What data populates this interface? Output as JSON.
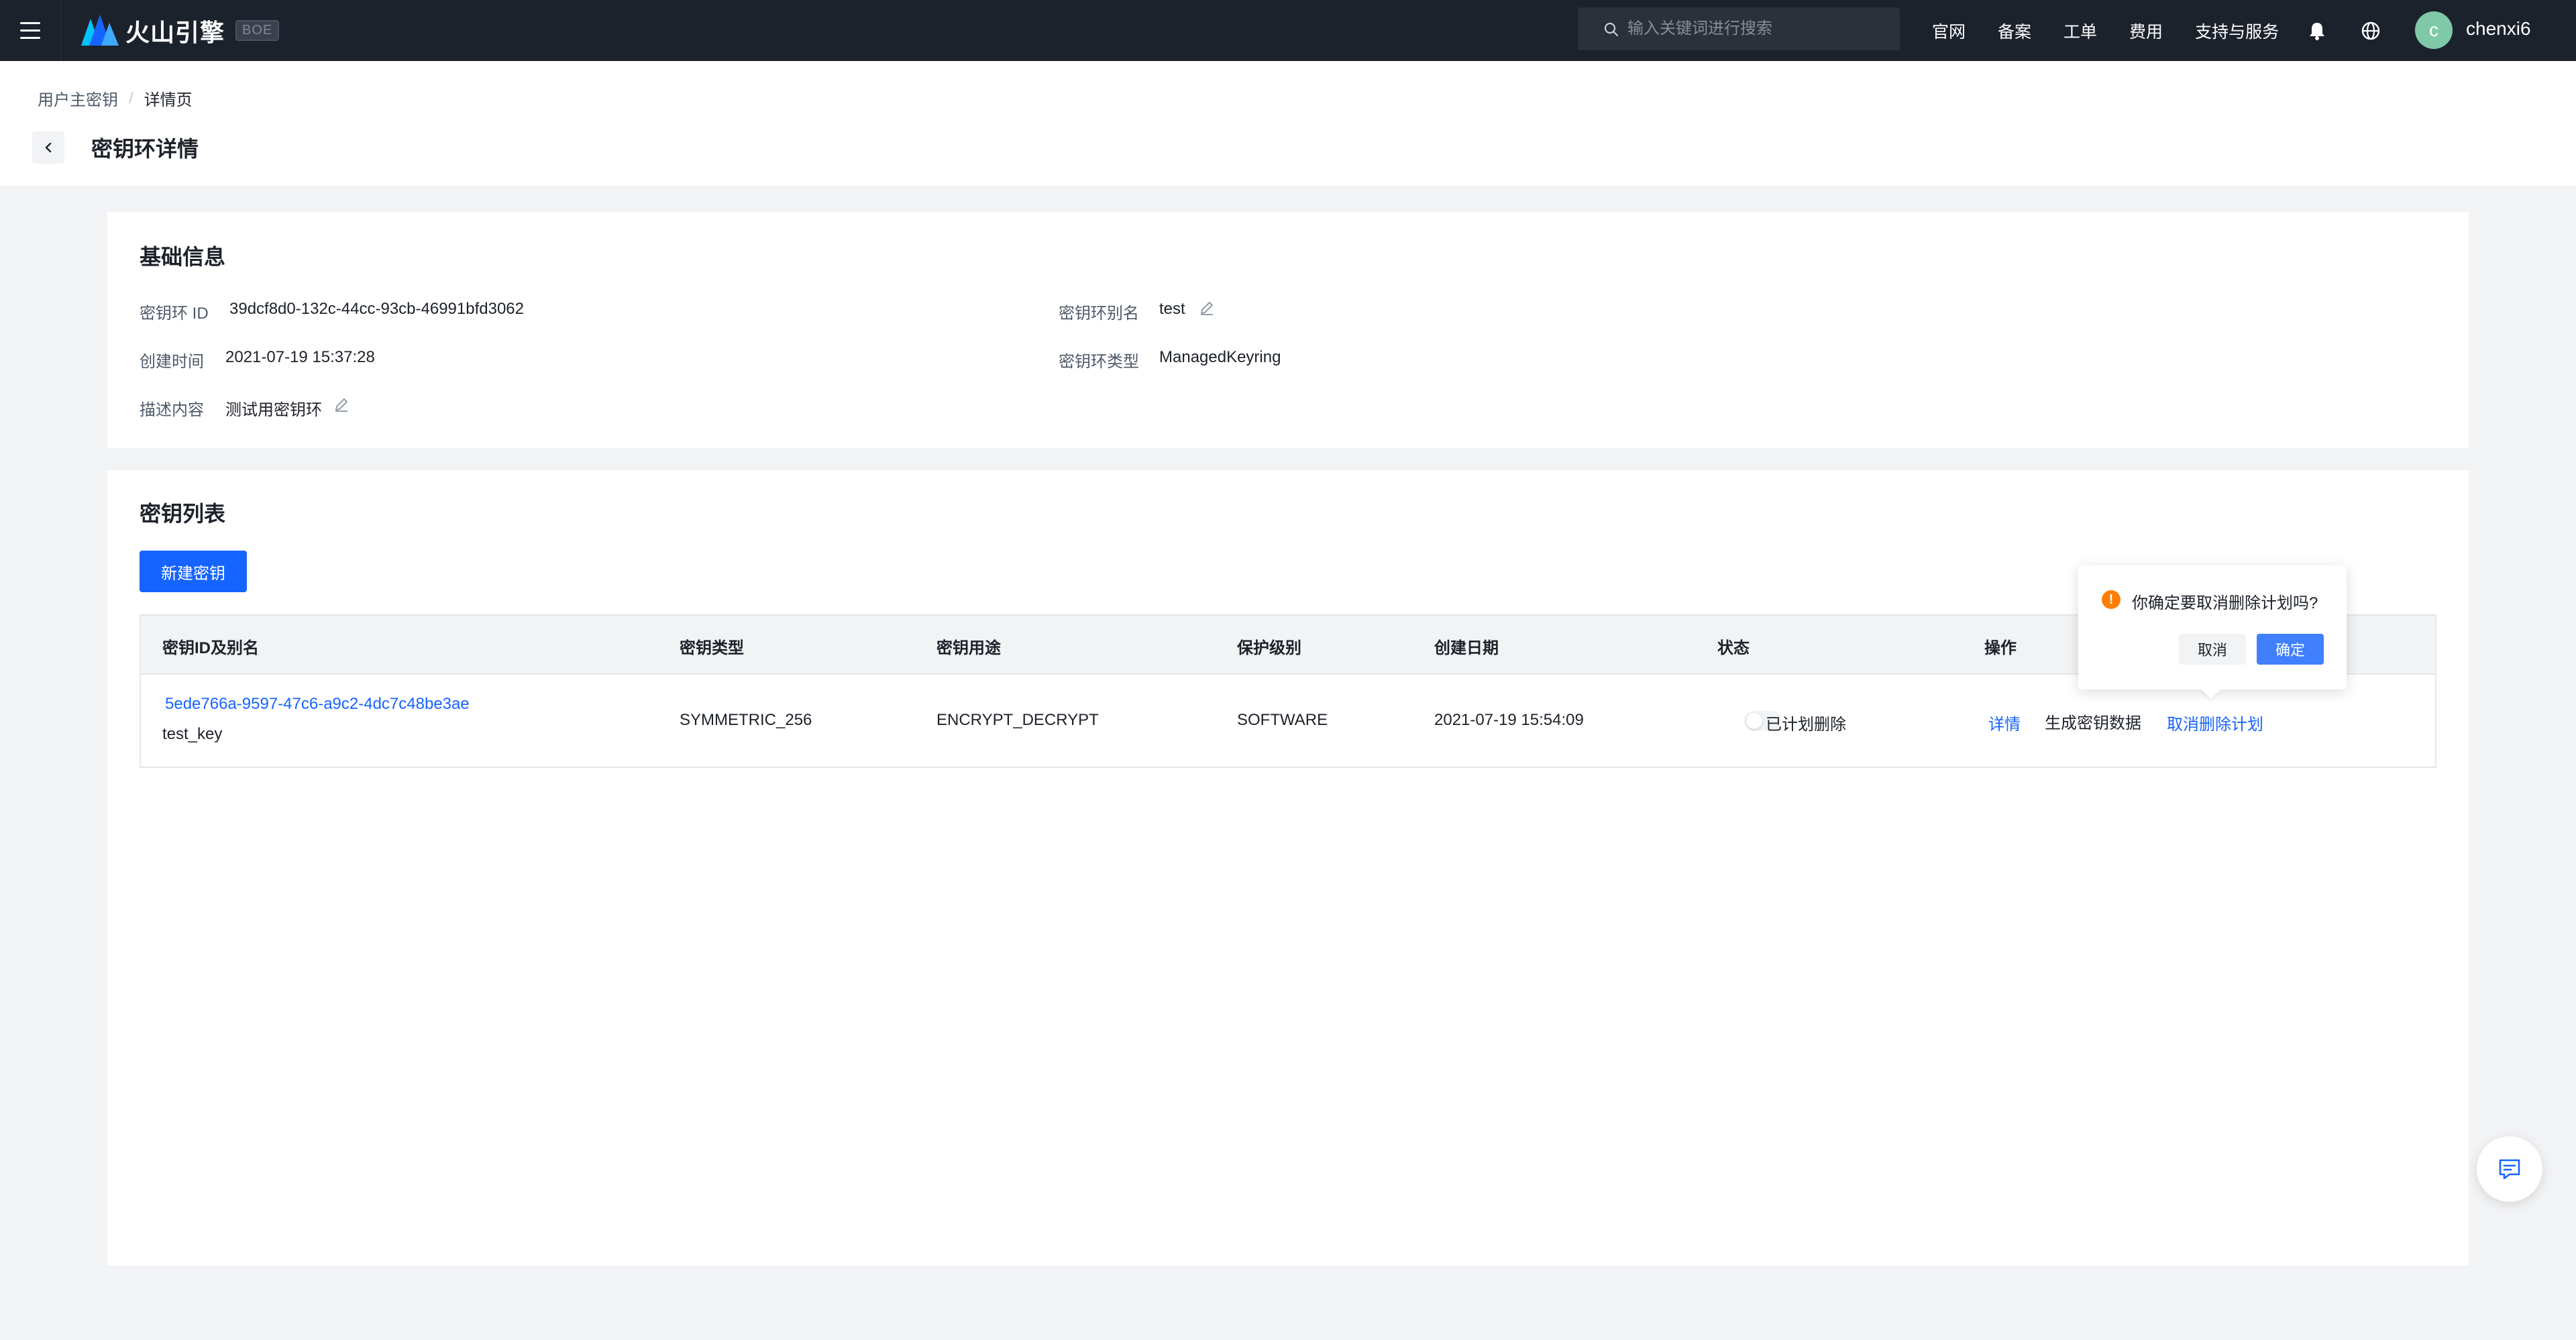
{
  "topbar": {
    "brand_name": "火山引擎",
    "env_badge": "BOE",
    "search_placeholder": "输入关键词进行搜索",
    "nav": [
      "官网",
      "备案",
      "工单",
      "费用",
      "支持与服务"
    ],
    "avatar_letter": "c",
    "username": "chenxi6"
  },
  "breadcrumb": {
    "parent": "用户主密钥",
    "separator": "/",
    "current": "详情页"
  },
  "page_title": "密钥环详情",
  "basic_info": {
    "title": "基础信息",
    "keyring_id_label": "密钥环 ID",
    "keyring_id": "39dcf8d0-132c-44cc-93cb-46991bfd3062",
    "alias_label": "密钥环别名",
    "alias": "test",
    "created_label": "创建时间",
    "created": "2021-07-19 15:37:28",
    "type_label": "密钥环类型",
    "type": "ManagedKeyring",
    "desc_label": "描述内容",
    "desc": "测试用密钥环"
  },
  "key_list": {
    "title": "密钥列表",
    "new_button": "新建密钥",
    "columns": [
      "密钥ID及别名",
      "密钥类型",
      "密钥用途",
      "保护级别",
      "创建日期",
      "状态",
      "操作"
    ],
    "rows": [
      {
        "key_id": "5ede766a-9597-47c6-a9c2-4dc7c48be3ae",
        "alias": "test_key",
        "key_type": "SYMMETRIC_256",
        "usage": "ENCRYPT_DECRYPT",
        "protection": "SOFTWARE",
        "created": "2021-07-19 15:54:09",
        "status": "已计划删除",
        "actions": {
          "detail": "详情",
          "generate": "生成密钥数据",
          "cancel_delete": "取消删除计划"
        }
      }
    ]
  },
  "popconfirm": {
    "message": "你确定要取消删除计划吗?",
    "cancel": "取消",
    "ok": "确定"
  },
  "colors": {
    "primary": "#1664ff",
    "topbar": "#1c222c",
    "warning": "#ff7d00",
    "avatar": "#7fc9a8"
  },
  "icons": [
    "menu-icon",
    "volcano-logo-icon",
    "search-icon",
    "bell-icon",
    "globe-icon",
    "back-arrow-icon",
    "edit-icon",
    "warning-icon",
    "feedback-icon"
  ]
}
